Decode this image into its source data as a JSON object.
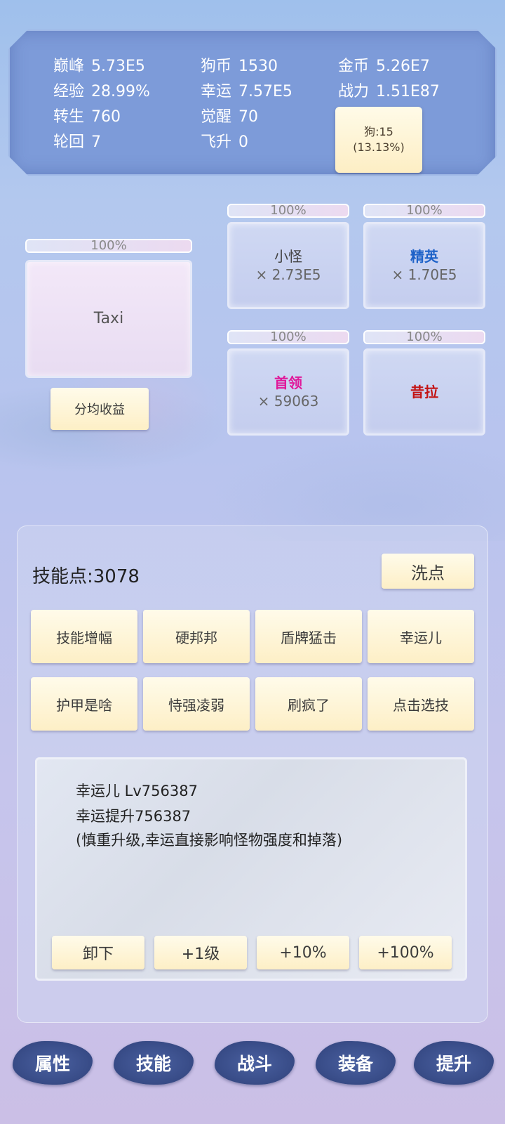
{
  "stats": {
    "col1": [
      {
        "label": "巅峰",
        "value": "5.73E5"
      },
      {
        "label": "经验",
        "value": "28.99%"
      },
      {
        "label": "转生",
        "value": "760"
      },
      {
        "label": "轮回",
        "value": "7"
      }
    ],
    "col2": [
      {
        "label": "狗币",
        "value": "1530"
      },
      {
        "label": "幸运",
        "value": "7.57E5"
      },
      {
        "label": "觉醒",
        "value": "70"
      },
      {
        "label": "飞升",
        "value": "0"
      }
    ],
    "col3": [
      {
        "label": "金币",
        "value": "5.26E7"
      },
      {
        "label": "战力",
        "value": "1.51E87"
      }
    ],
    "dog": {
      "line1": "狗:15",
      "line2": "(13.13%)"
    }
  },
  "battle": {
    "main": {
      "progress": "100%",
      "progress_value": 1.0,
      "name": "Taxi"
    },
    "share_button": "分均收益",
    "monsters": [
      {
        "progress": "100%",
        "progress_value": 1.0,
        "name": "小怪",
        "count": "× 2.73E5",
        "color": "#444444"
      },
      {
        "progress": "100%",
        "progress_value": 1.0,
        "name": "精英",
        "count": "× 1.70E5",
        "color": "#1e62c8"
      },
      {
        "progress": "100%",
        "progress_value": 1.0,
        "name": "首领",
        "count": "× 59063",
        "color": "#e0189a"
      },
      {
        "progress": "100%",
        "progress_value": 1.0,
        "name": "昔拉",
        "count": "",
        "color": "#c31414"
      }
    ]
  },
  "skills": {
    "points_label": "技能点:3078",
    "reset_button": "洗点",
    "buttons": [
      "技能增幅",
      "硬邦邦",
      "盾牌猛击",
      "幸运儿",
      "护甲是啥",
      "恃强凌弱",
      "刷疯了",
      "点击选技"
    ],
    "desc": {
      "line1": "幸运儿 Lv756387",
      "line2": "幸运提升756387",
      "line3": "(慎重升级,幸运直接影响怪物强度和掉落)"
    },
    "actions": [
      "卸下",
      "+1级",
      "+10%",
      "+100%"
    ]
  },
  "nav": [
    "属性",
    "技能",
    "战斗",
    "装备",
    "提升"
  ]
}
